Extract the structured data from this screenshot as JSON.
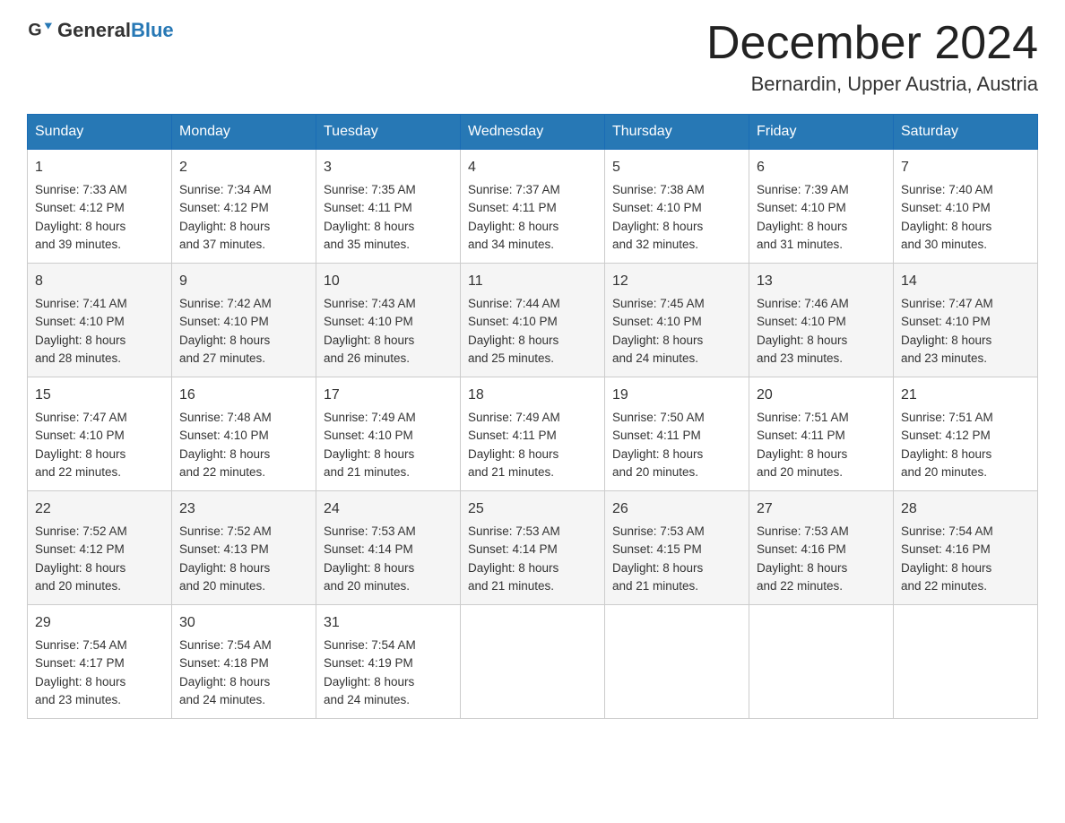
{
  "header": {
    "logo_general": "General",
    "logo_blue": "Blue",
    "month_title": "December 2024",
    "location": "Bernardin, Upper Austria, Austria"
  },
  "weekdays": [
    "Sunday",
    "Monday",
    "Tuesday",
    "Wednesday",
    "Thursday",
    "Friday",
    "Saturday"
  ],
  "weeks": [
    [
      {
        "day": "1",
        "sunrise": "7:33 AM",
        "sunset": "4:12 PM",
        "daylight": "8 hours and 39 minutes."
      },
      {
        "day": "2",
        "sunrise": "7:34 AM",
        "sunset": "4:12 PM",
        "daylight": "8 hours and 37 minutes."
      },
      {
        "day": "3",
        "sunrise": "7:35 AM",
        "sunset": "4:11 PM",
        "daylight": "8 hours and 35 minutes."
      },
      {
        "day": "4",
        "sunrise": "7:37 AM",
        "sunset": "4:11 PM",
        "daylight": "8 hours and 34 minutes."
      },
      {
        "day": "5",
        "sunrise": "7:38 AM",
        "sunset": "4:10 PM",
        "daylight": "8 hours and 32 minutes."
      },
      {
        "day": "6",
        "sunrise": "7:39 AM",
        "sunset": "4:10 PM",
        "daylight": "8 hours and 31 minutes."
      },
      {
        "day": "7",
        "sunrise": "7:40 AM",
        "sunset": "4:10 PM",
        "daylight": "8 hours and 30 minutes."
      }
    ],
    [
      {
        "day": "8",
        "sunrise": "7:41 AM",
        "sunset": "4:10 PM",
        "daylight": "8 hours and 28 minutes."
      },
      {
        "day": "9",
        "sunrise": "7:42 AM",
        "sunset": "4:10 PM",
        "daylight": "8 hours and 27 minutes."
      },
      {
        "day": "10",
        "sunrise": "7:43 AM",
        "sunset": "4:10 PM",
        "daylight": "8 hours and 26 minutes."
      },
      {
        "day": "11",
        "sunrise": "7:44 AM",
        "sunset": "4:10 PM",
        "daylight": "8 hours and 25 minutes."
      },
      {
        "day": "12",
        "sunrise": "7:45 AM",
        "sunset": "4:10 PM",
        "daylight": "8 hours and 24 minutes."
      },
      {
        "day": "13",
        "sunrise": "7:46 AM",
        "sunset": "4:10 PM",
        "daylight": "8 hours and 23 minutes."
      },
      {
        "day": "14",
        "sunrise": "7:47 AM",
        "sunset": "4:10 PM",
        "daylight": "8 hours and 23 minutes."
      }
    ],
    [
      {
        "day": "15",
        "sunrise": "7:47 AM",
        "sunset": "4:10 PM",
        "daylight": "8 hours and 22 minutes."
      },
      {
        "day": "16",
        "sunrise": "7:48 AM",
        "sunset": "4:10 PM",
        "daylight": "8 hours and 22 minutes."
      },
      {
        "day": "17",
        "sunrise": "7:49 AM",
        "sunset": "4:10 PM",
        "daylight": "8 hours and 21 minutes."
      },
      {
        "day": "18",
        "sunrise": "7:49 AM",
        "sunset": "4:11 PM",
        "daylight": "8 hours and 21 minutes."
      },
      {
        "day": "19",
        "sunrise": "7:50 AM",
        "sunset": "4:11 PM",
        "daylight": "8 hours and 20 minutes."
      },
      {
        "day": "20",
        "sunrise": "7:51 AM",
        "sunset": "4:11 PM",
        "daylight": "8 hours and 20 minutes."
      },
      {
        "day": "21",
        "sunrise": "7:51 AM",
        "sunset": "4:12 PM",
        "daylight": "8 hours and 20 minutes."
      }
    ],
    [
      {
        "day": "22",
        "sunrise": "7:52 AM",
        "sunset": "4:12 PM",
        "daylight": "8 hours and 20 minutes."
      },
      {
        "day": "23",
        "sunrise": "7:52 AM",
        "sunset": "4:13 PM",
        "daylight": "8 hours and 20 minutes."
      },
      {
        "day": "24",
        "sunrise": "7:53 AM",
        "sunset": "4:14 PM",
        "daylight": "8 hours and 20 minutes."
      },
      {
        "day": "25",
        "sunrise": "7:53 AM",
        "sunset": "4:14 PM",
        "daylight": "8 hours and 21 minutes."
      },
      {
        "day": "26",
        "sunrise": "7:53 AM",
        "sunset": "4:15 PM",
        "daylight": "8 hours and 21 minutes."
      },
      {
        "day": "27",
        "sunrise": "7:53 AM",
        "sunset": "4:16 PM",
        "daylight": "8 hours and 22 minutes."
      },
      {
        "day": "28",
        "sunrise": "7:54 AM",
        "sunset": "4:16 PM",
        "daylight": "8 hours and 22 minutes."
      }
    ],
    [
      {
        "day": "29",
        "sunrise": "7:54 AM",
        "sunset": "4:17 PM",
        "daylight": "8 hours and 23 minutes."
      },
      {
        "day": "30",
        "sunrise": "7:54 AM",
        "sunset": "4:18 PM",
        "daylight": "8 hours and 24 minutes."
      },
      {
        "day": "31",
        "sunrise": "7:54 AM",
        "sunset": "4:19 PM",
        "daylight": "8 hours and 24 minutes."
      },
      null,
      null,
      null,
      null
    ]
  ],
  "labels": {
    "sunrise": "Sunrise:",
    "sunset": "Sunset:",
    "daylight": "Daylight:"
  }
}
